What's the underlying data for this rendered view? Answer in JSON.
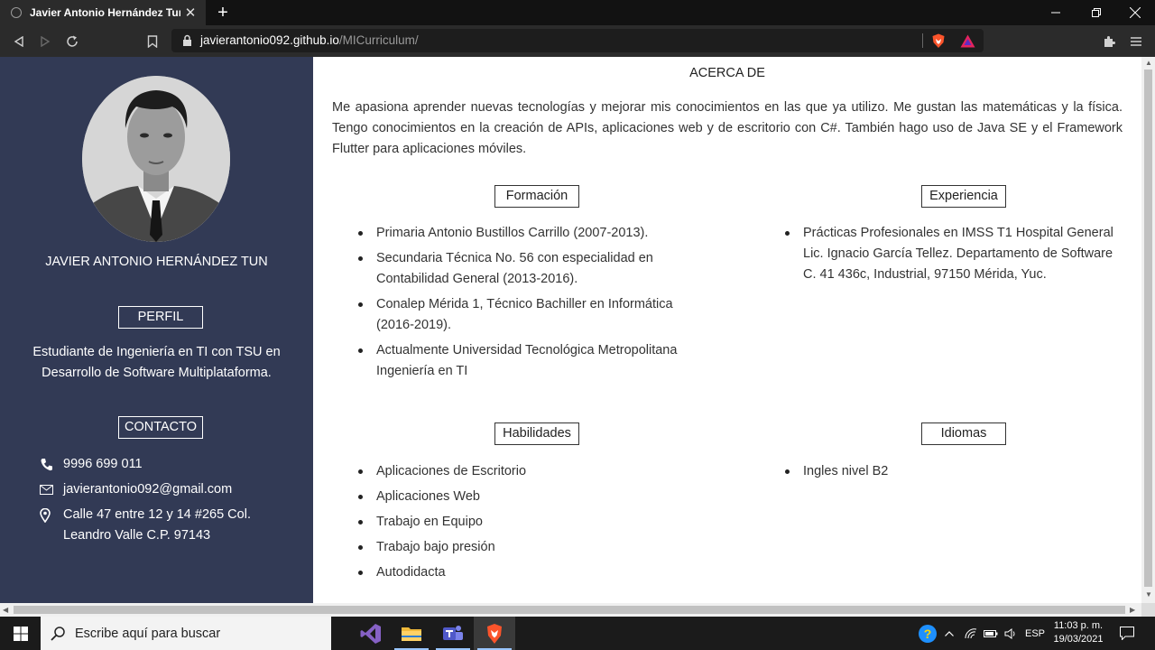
{
  "browser": {
    "tab_title": "Javier Antonio Hernández Tun",
    "url_domain": "javierantonio092.github.io",
    "url_path": "/MICurriculum/"
  },
  "sidebar": {
    "name": "JAVIER ANTONIO HERNÁNDEZ TUN",
    "profile_heading": "PERFIL",
    "profile_text": "Estudiante de Ingeniería en TI con TSU en Desarrollo de Software Multiplataforma.",
    "contact_heading": "CONTACTO",
    "phone": "9996 699 011",
    "email": "javierantonio092@gmail.com",
    "address": "Calle 47 entre 12 y 14 #265 Col. Leandro Valle C.P. 97143"
  },
  "main": {
    "about_title": "ACERCA DE",
    "about_text": "Me apasiona aprender nuevas tecnologías y mejorar mis conocimientos en las que ya utilizo. Me gustan las matemáticas y la física. Tengo conocimientos en la creación de APIs, aplicaciones web y de escritorio con C#. También hago uso de Java SE y el Framework Flutter para aplicaciones móviles.",
    "formacion": {
      "heading": "Formación",
      "items": [
        "Primaria Antonio Bustillos Carrillo (2007-2013).",
        "Secundaria Técnica No. 56 con especialidad en Contabilidad General (2013-2016).",
        "Conalep Mérida 1, Técnico Bachiller en Informática (2016-2019).",
        "Actualmente Universidad Tecnológica Metropolitana Ingeniería en TI"
      ]
    },
    "experiencia": {
      "heading": "Experiencia",
      "items": [
        "Prácticas Profesionales en IMSS T1 Hospital General Lic. Ignacio García Tellez. Departamento de Software C. 41 436c, Industrial, 97150 Mérida, Yuc."
      ]
    },
    "habilidades": {
      "heading": "Habilidades",
      "items": [
        "Aplicaciones de Escritorio",
        "Aplicaciones Web",
        "Trabajo en Equipo",
        "Trabajo bajo presión",
        "Autodidacta"
      ]
    },
    "idiomas": {
      "heading": "Idiomas",
      "items": [
        "Ingles nivel B2"
      ]
    }
  },
  "taskbar": {
    "search_placeholder": "Escribe aquí para buscar",
    "language": "ESP",
    "time": "11:03 p. m.",
    "date": "19/03/2021",
    "apps": [
      "visual-studio",
      "file-explorer",
      "teams",
      "brave"
    ]
  },
  "colors": {
    "sidebar_bg": "#323a55",
    "chrome_bg": "#2b2b2b",
    "taskbar_bg": "#1b1b1b"
  }
}
